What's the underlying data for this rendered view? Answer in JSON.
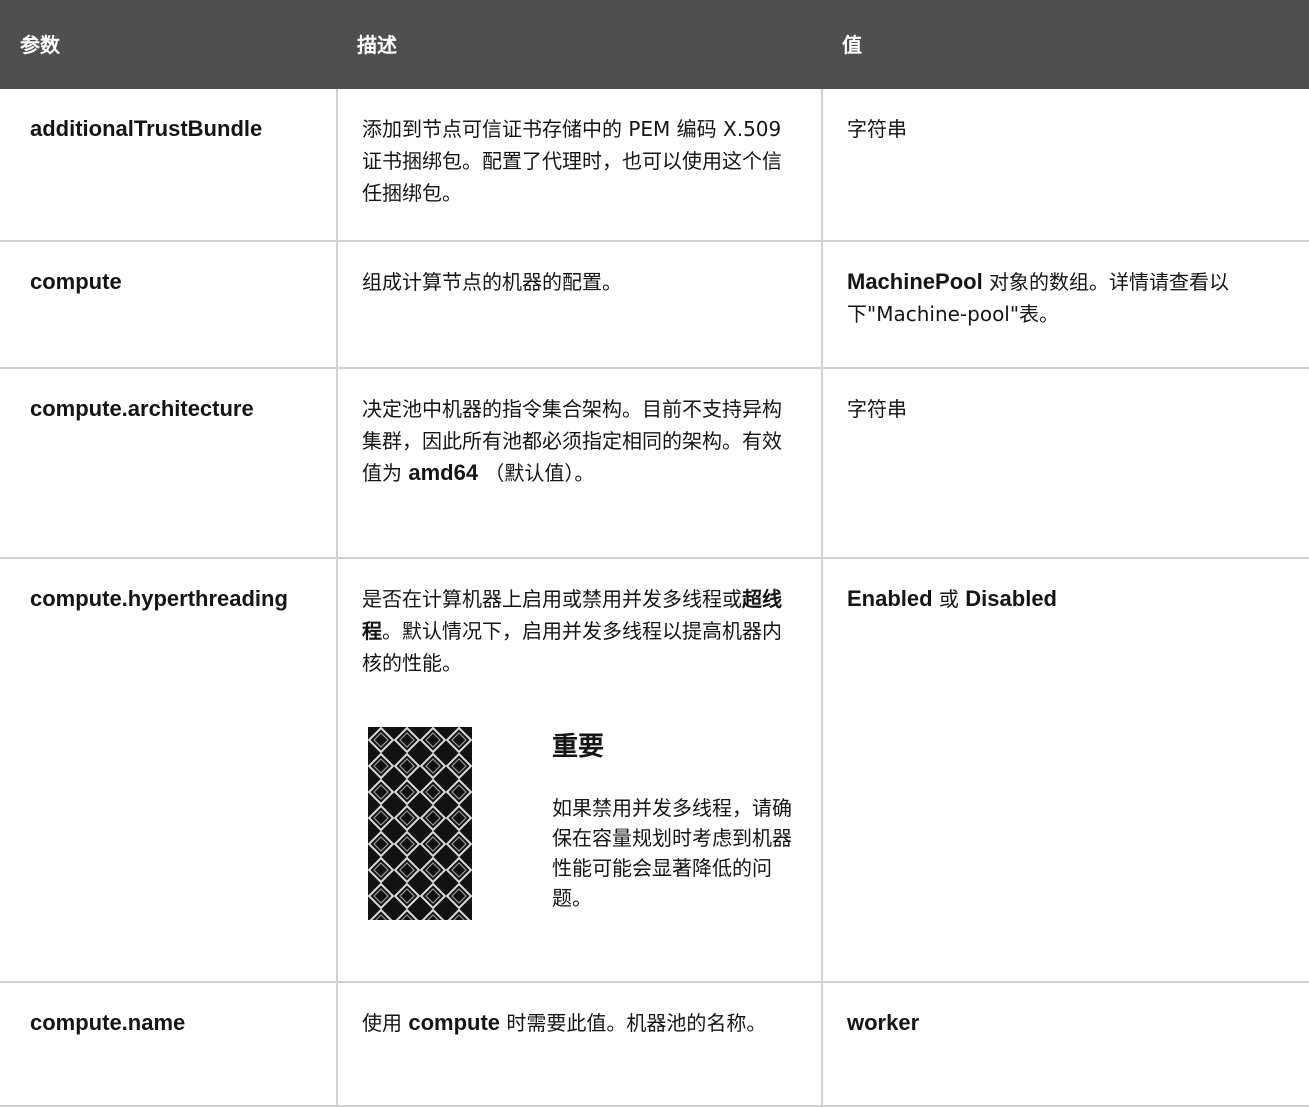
{
  "header": {
    "param": "参数",
    "desc": "描述",
    "value": "值"
  },
  "rows": [
    {
      "param": "additionalTrustBundle",
      "desc": "添加到节点可信证书存储中的 PEM 编码 X.509 证书捆绑包。配置了代理时，也可以使用这个信任捆绑包。",
      "value": "字符串"
    },
    {
      "param": "compute",
      "desc": "组成计算节点的机器的配置。",
      "value_bold": "MachinePool",
      "value_rest": " 对象的数组。详情请查看以下\"Machine-pool\"表。"
    },
    {
      "param": "compute.architecture",
      "desc_pre": "决定池中机器的指令集合架构。目前不支持异构集群，因此所有池都必须指定相同的架构。有效值为 ",
      "desc_bold": "amd64",
      "desc_post": " （默认值）。",
      "value": "字符串"
    },
    {
      "param": "compute.hyperthreading",
      "desc_pre": "是否在计算机器上启用或禁用并发多线程或",
      "desc_bold": "超线程",
      "desc_post": "。默认情况下，启用并发多线程以提高机器内核的性能。",
      "important_title": "重要",
      "important_text": "如果禁用并发多线程，请确保在容量规划时考虑到机器性能可能会显著降低的问题。",
      "value_a": "Enabled",
      "value_or": " 或 ",
      "value_b": "Disabled"
    },
    {
      "param": "compute.name",
      "desc_pre": "使用 ",
      "desc_bold": "compute",
      "desc_post": " 时需要此值。机器池的名称。",
      "value": "worker"
    }
  ]
}
